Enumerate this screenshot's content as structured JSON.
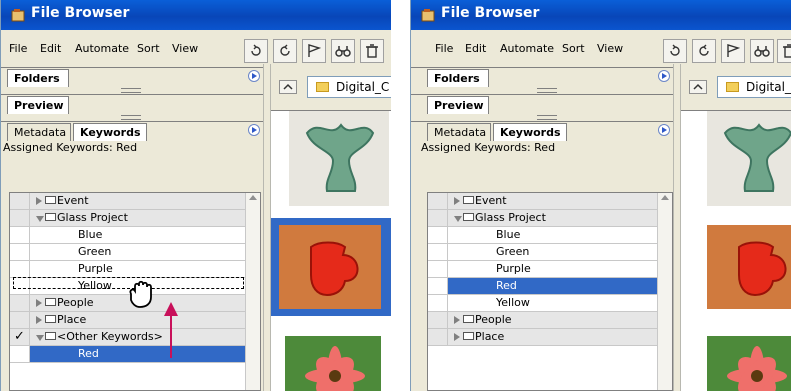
{
  "app": {
    "title": "File Browser"
  },
  "menu": [
    "File",
    "Edit",
    "Automate",
    "Sort",
    "View"
  ],
  "toolbar": [
    "rotate-ccw-icon",
    "rotate-cw-icon",
    "flag-icon",
    "binoculars-icon",
    "trash-icon"
  ],
  "tabs": {
    "folders": "Folders",
    "preview": "Preview",
    "metadata": "Metadata",
    "keywords": "Keywords"
  },
  "assigned": "Assigned Keywords: Red",
  "path_left": "Digital_C",
  "path_right": "Digital_",
  "left_keywords": [
    {
      "label": "Event",
      "kind": "set",
      "expanded": false,
      "checked": ""
    },
    {
      "label": "Glass Project",
      "kind": "set",
      "expanded": true,
      "checked": ""
    },
    {
      "label": "Blue",
      "kind": "kw",
      "checked": ""
    },
    {
      "label": "Green",
      "kind": "kw",
      "checked": ""
    },
    {
      "label": "Purple",
      "kind": "kw",
      "checked": ""
    },
    {
      "label": "Yellow",
      "kind": "kw",
      "checked": ""
    },
    {
      "label": "People",
      "kind": "set",
      "expanded": false,
      "checked": ""
    },
    {
      "label": "Place",
      "kind": "set",
      "expanded": false,
      "checked": ""
    },
    {
      "label": "<Other Keywords>",
      "kind": "set",
      "expanded": true,
      "checked": "✓"
    },
    {
      "label": "Red",
      "kind": "kw",
      "checked": "✓",
      "selected": true
    }
  ],
  "right_keywords": [
    {
      "label": "Event",
      "kind": "set",
      "expanded": false,
      "checked": ""
    },
    {
      "label": "Glass Project",
      "kind": "set",
      "expanded": true,
      "checked": ""
    },
    {
      "label": "Blue",
      "kind": "kw",
      "checked": ""
    },
    {
      "label": "Green",
      "kind": "kw",
      "checked": ""
    },
    {
      "label": "Purple",
      "kind": "kw",
      "checked": ""
    },
    {
      "label": "Red",
      "kind": "kw",
      "checked": "✓",
      "selected": true
    },
    {
      "label": "Yellow",
      "kind": "kw",
      "checked": ""
    },
    {
      "label": "People",
      "kind": "set",
      "expanded": false,
      "checked": ""
    },
    {
      "label": "Place",
      "kind": "set",
      "expanded": false,
      "checked": ""
    }
  ],
  "colors": {
    "titlebar": "#0a5fd8",
    "selection": "#3169c6",
    "arrow": "#c8105a"
  }
}
